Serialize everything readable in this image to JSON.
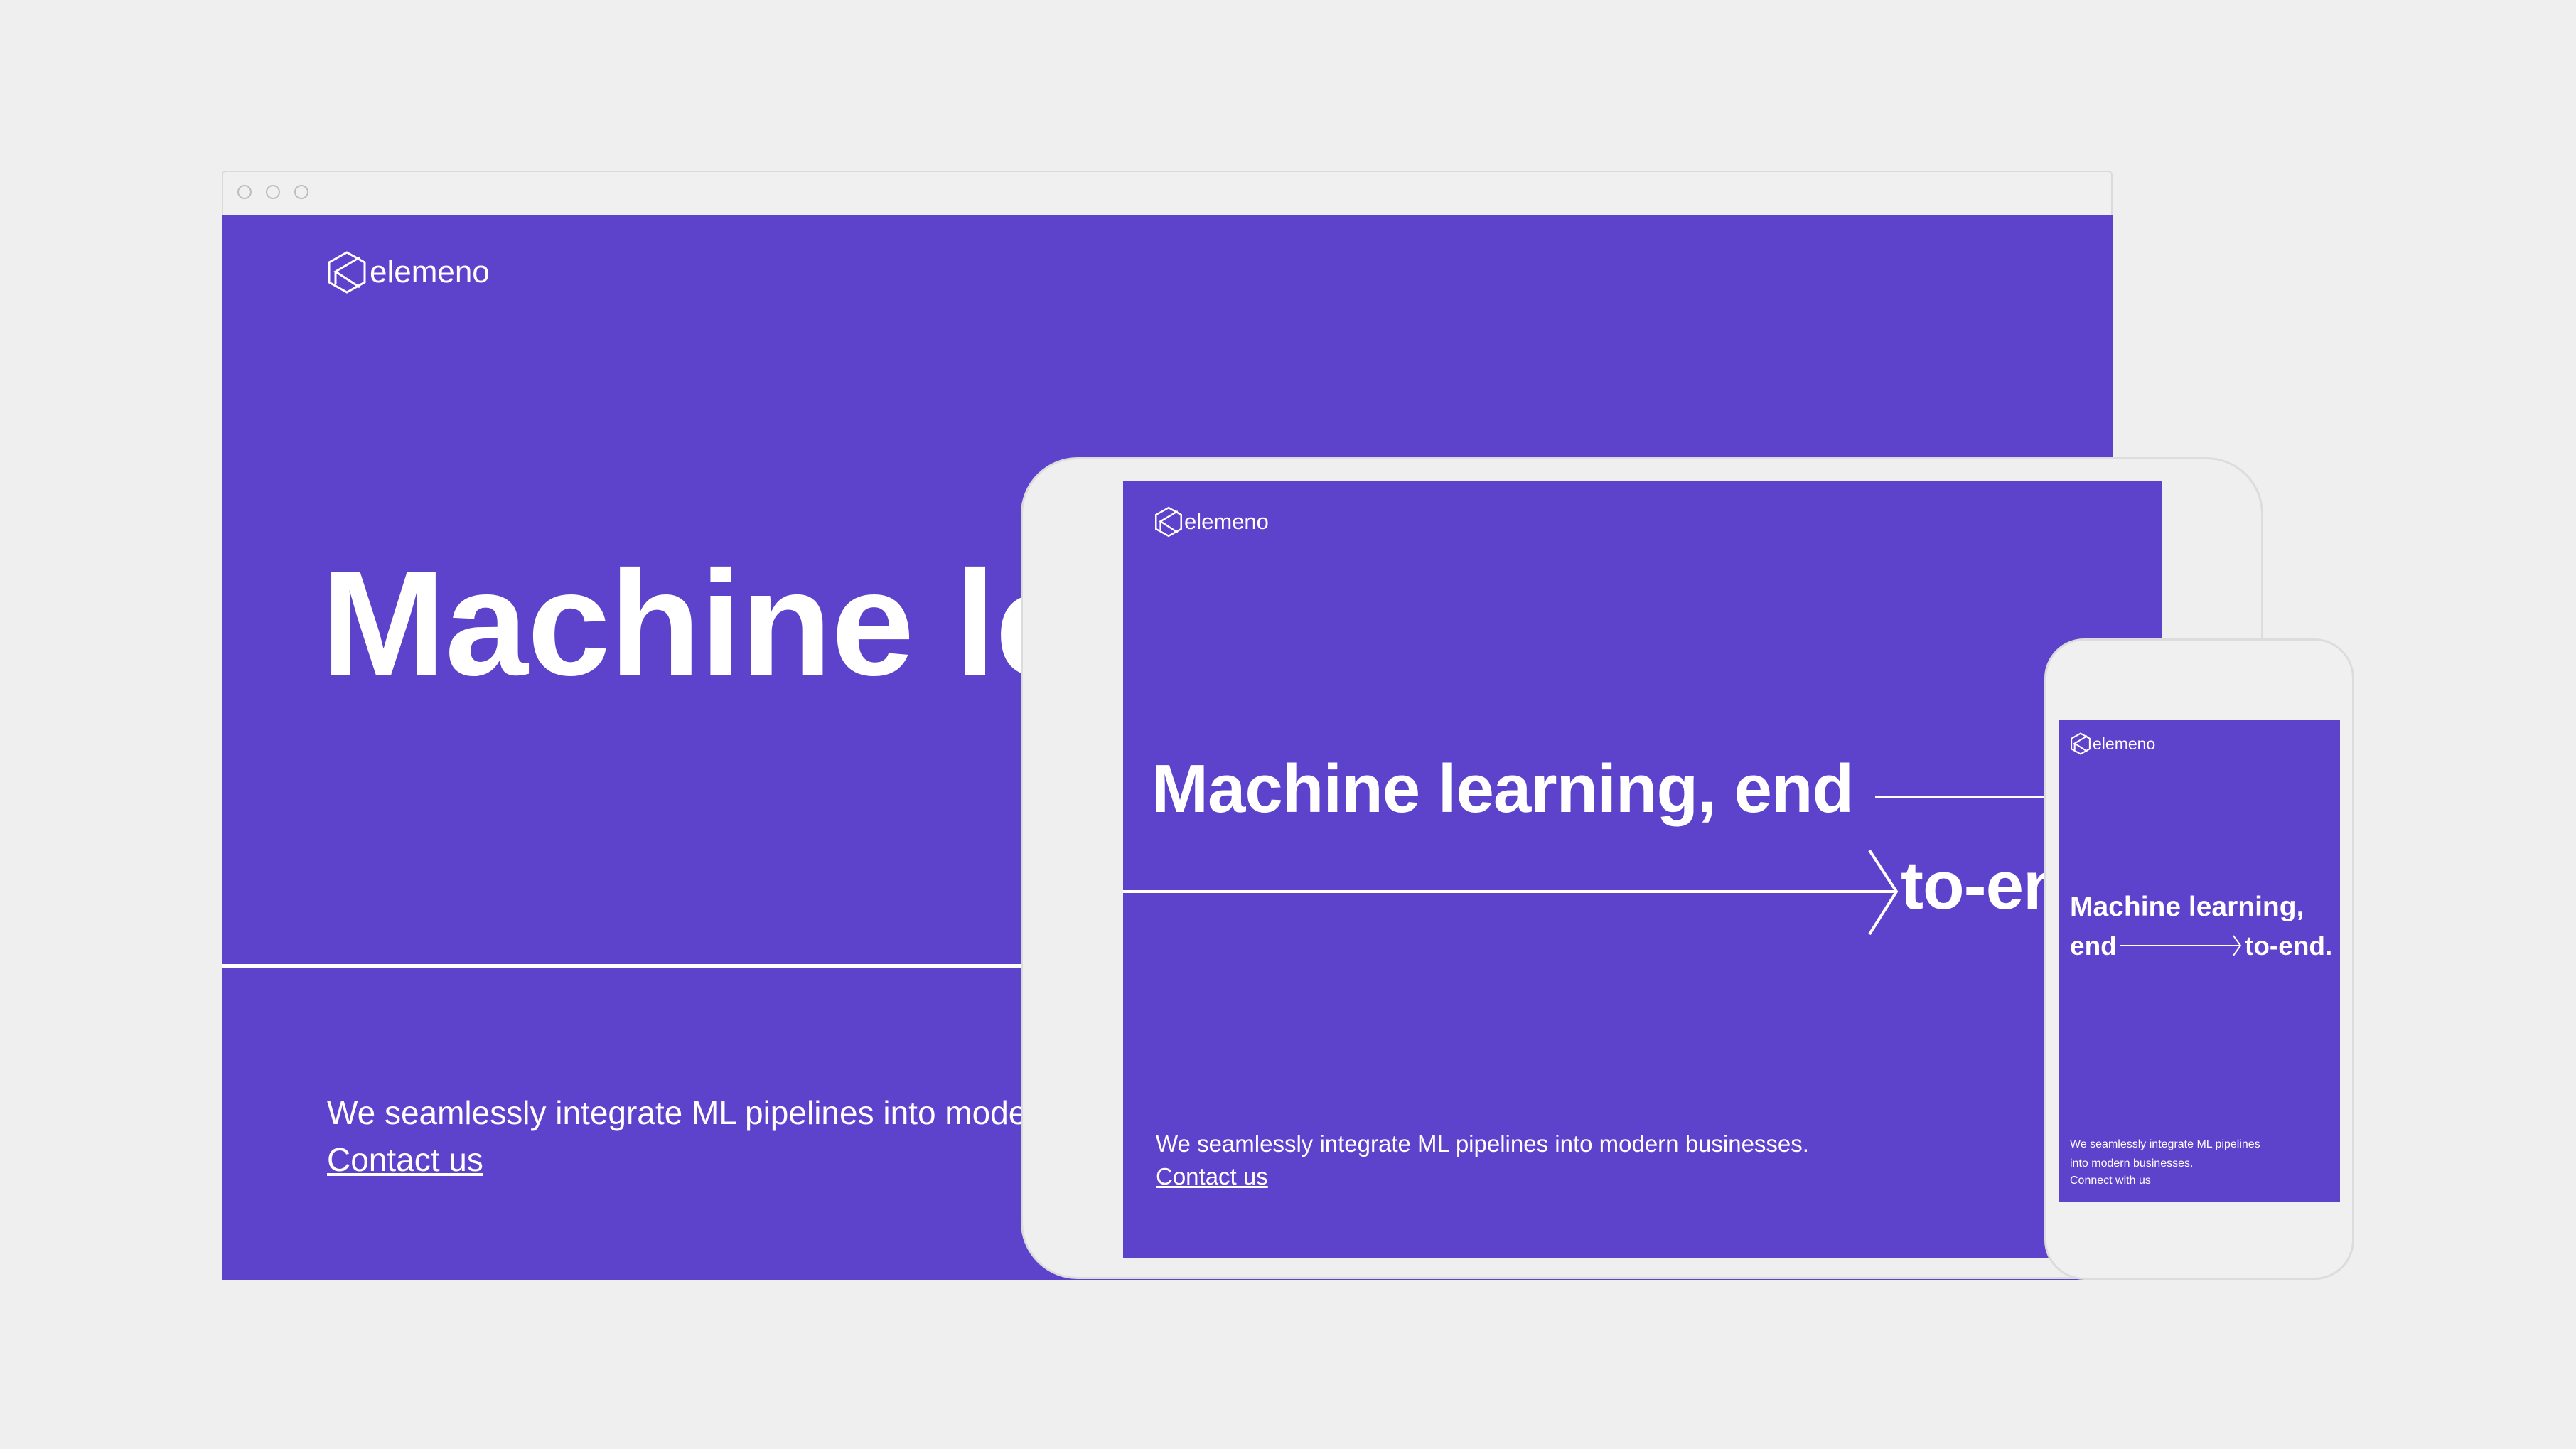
{
  "brand": {
    "name": "elemeno",
    "purple": "#5d42cc",
    "background": "#efefef"
  },
  "desktop": {
    "logo_text": "elemeno",
    "headline": "Machine le",
    "tagline": "We seamlessly integrate ML pipelines into mode",
    "cta": "Contact us"
  },
  "tablet": {
    "logo_text": "elemeno",
    "headline_line1": "Machine learning, end",
    "headline_line2": "to-en",
    "tagline": "We seamlessly integrate ML pipelines into modern businesses.",
    "cta": "Contact us"
  },
  "phone": {
    "logo_text": "elemeno",
    "headline_line1": "Machine learning,",
    "headline_end": "end",
    "headline_to_end": "to-end.",
    "tagline_line1": "We seamlessly integrate ML pipelines",
    "tagline_line2": "into modern businesses.",
    "cta": "Connect with us"
  }
}
